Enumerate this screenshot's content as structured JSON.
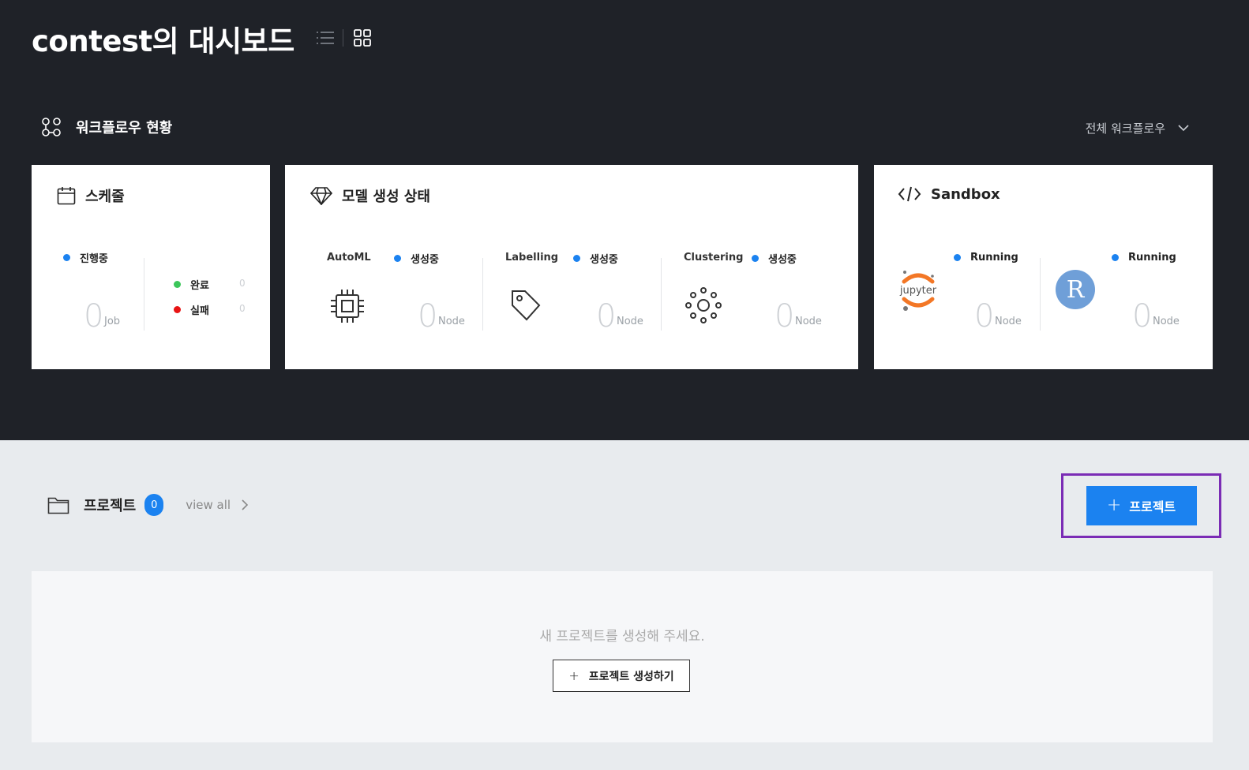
{
  "header": {
    "title": "contest의 대시보드"
  },
  "workflow": {
    "section_title": "워크플로우 현황",
    "filter_label": "전체 워크플로우",
    "schedule": {
      "title": "스케줄",
      "in_progress_label": "진행중",
      "in_progress_count": "0",
      "in_progress_unit": "Job",
      "done_label": "완료",
      "done_count": "0",
      "failed_label": "실패",
      "failed_count": "0",
      "colors": {
        "in_progress": "#1b82f0",
        "done": "#3cc65a",
        "failed": "#e81414"
      }
    },
    "model": {
      "title": "모델 생성 상태",
      "items": [
        {
          "name": "AutoML",
          "status": "생성중",
          "count": "0",
          "unit": "Node"
        },
        {
          "name": "Labelling",
          "status": "생성중",
          "count": "0",
          "unit": "Node"
        },
        {
          "name": "Clustering",
          "status": "생성중",
          "count": "0",
          "unit": "Node"
        }
      ]
    },
    "sandbox": {
      "title": "Sandbox",
      "items": [
        {
          "logo": "jupyter",
          "logo_text": "jupyter",
          "status": "Running",
          "count": "0",
          "unit": "Node"
        },
        {
          "logo": "R",
          "logo_text": "R",
          "status": "Running",
          "count": "0",
          "unit": "Node"
        }
      ]
    }
  },
  "projects": {
    "title": "프로젝트",
    "count": "0",
    "view_all": "view all",
    "create_button": "프로젝트",
    "empty_message": "새 프로젝트를 생성해 주세요.",
    "empty_create_button": "프로젝트 생성하기"
  },
  "colors": {
    "accent": "#1b82f0",
    "header_bg": "#1f2228",
    "highlight": "#7b2cb5"
  }
}
